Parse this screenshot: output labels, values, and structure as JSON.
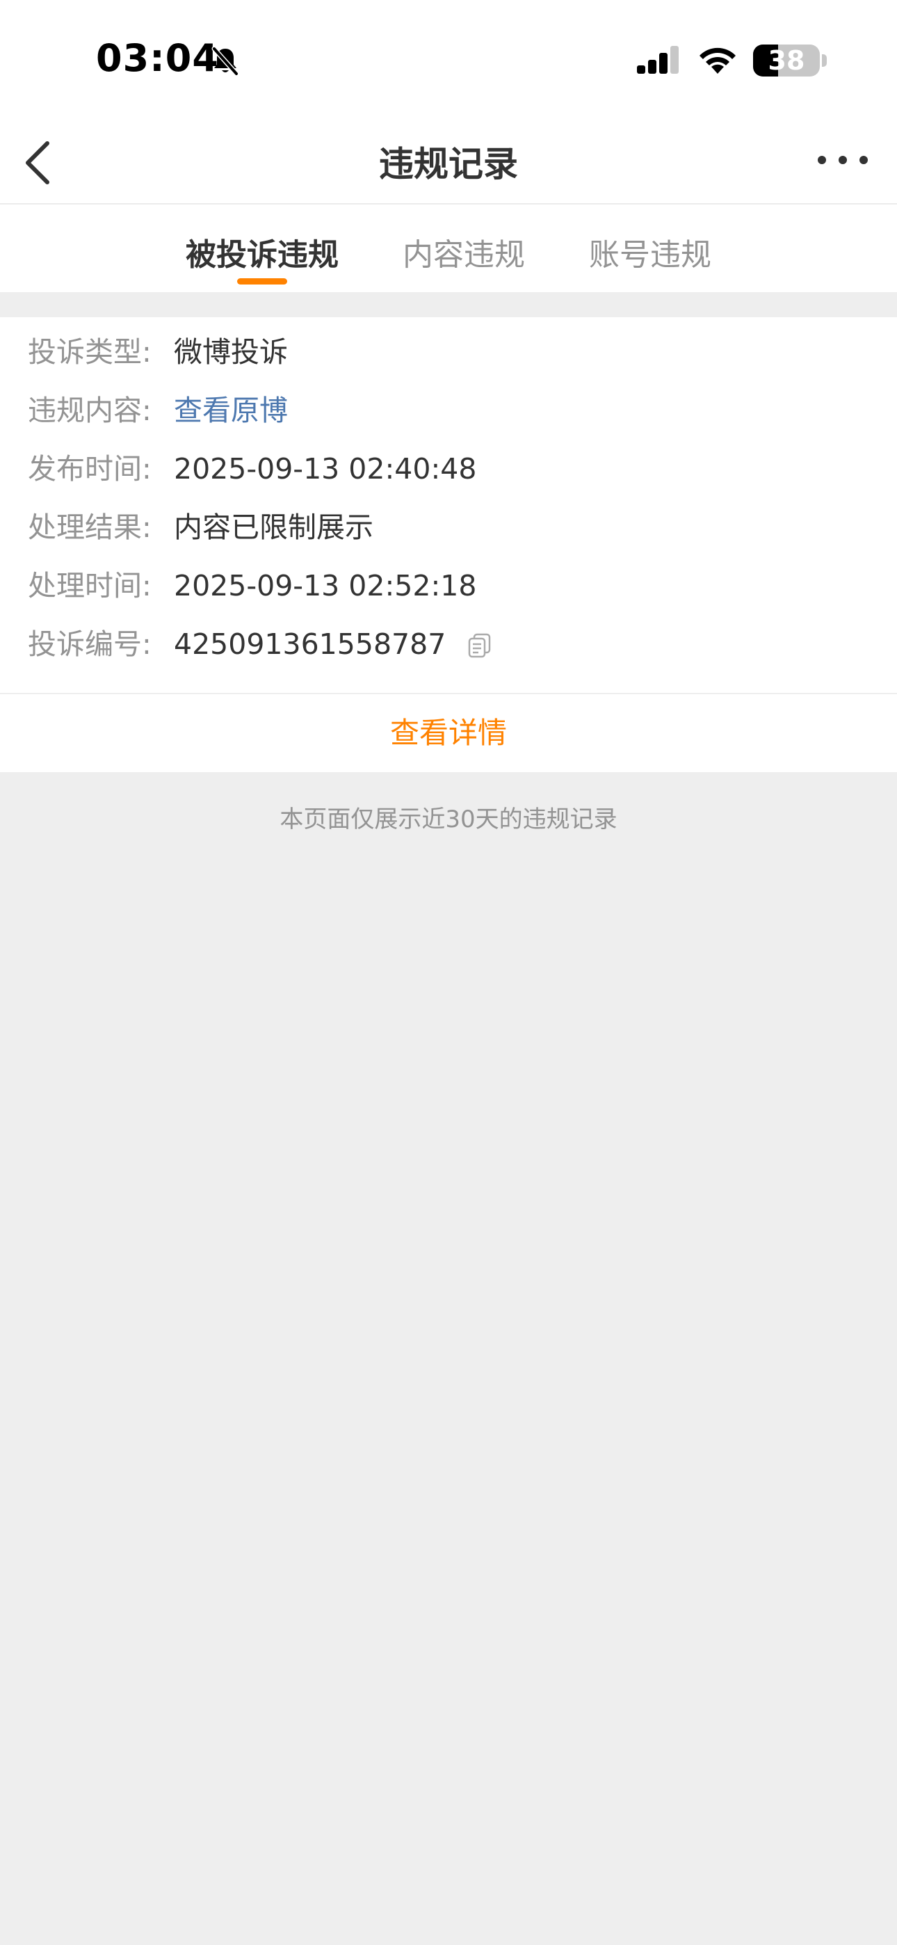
{
  "status_bar": {
    "time": "03:04",
    "battery_level": "38",
    "battery_fraction": 0.38,
    "icons": [
      "bell-slash-icon",
      "cellular-signal-icon",
      "wifi-icon",
      "battery-icon"
    ]
  },
  "nav": {
    "title": "违规记录",
    "icons": [
      "chevron-left-icon",
      "more-horizontal-icon"
    ]
  },
  "tabs": [
    {
      "label": "被投诉违规",
      "active": true
    },
    {
      "label": "内容违规",
      "active": false
    },
    {
      "label": "账号违规",
      "active": false
    }
  ],
  "record": {
    "rows": [
      {
        "label": "投诉类型:",
        "value": "微博投诉"
      },
      {
        "label": "违规内容:",
        "value": "查看原博"
      },
      {
        "label": "发布时间:",
        "value": "2025-09-13 02:40:48"
      },
      {
        "label": "处理结果:",
        "value": "内容已限制展示"
      },
      {
        "label": "处理时间:",
        "value": "2025-09-13 02:52:18"
      },
      {
        "label": "投诉编号:",
        "value": "425091361558787"
      }
    ],
    "detail_label": "查看详情"
  },
  "footer": {
    "note": "本页面仅展示近30天的违规记录"
  },
  "colors": {
    "accent": "#FF8200",
    "link": "#4D78AF",
    "text_primary": "#333333",
    "text_secondary": "#939393",
    "background": "#EEEEEE"
  }
}
